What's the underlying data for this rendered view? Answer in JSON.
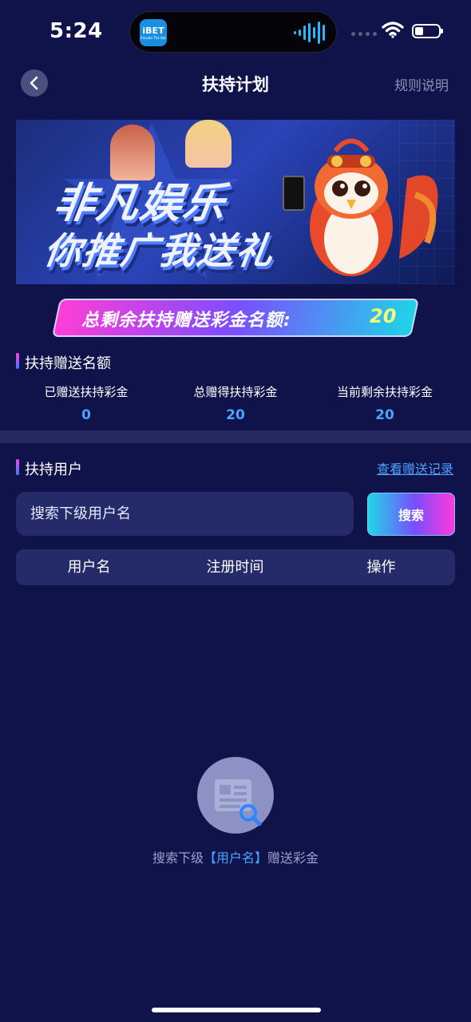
{
  "status_bar": {
    "time": "5:24",
    "app_badge": "iBET",
    "app_badge_sub": "Elevate The Bet"
  },
  "nav": {
    "title": "扶持计划",
    "rules_label": "规则说明",
    "back_icon": "chevron-left-icon"
  },
  "banner": {
    "line1": "非凡娱乐",
    "line2": "你推广我送礼"
  },
  "quota": {
    "label": "总剩余扶持赠送彩金名额:",
    "value": "20"
  },
  "support_section": {
    "title": "扶持赠送名额",
    "stats": [
      {
        "label": "已赠送扶持彩金",
        "value": "0"
      },
      {
        "label": "总赠得扶持彩金",
        "value": "20"
      },
      {
        "label": "当前剩余扶持彩金",
        "value": "20"
      }
    ]
  },
  "users_section": {
    "title": "扶持用户",
    "records_link": "查看赠送记录",
    "search_placeholder": "搜索下级用户名",
    "search_button": "搜索",
    "columns": [
      "用户名",
      "注册时间",
      "操作"
    ]
  },
  "empty_state": {
    "prefix": "搜索下级",
    "highlight": "【用户名】",
    "suffix": "赠送彩金",
    "icon": "document-search-icon"
  },
  "colors": {
    "background": "#10134a",
    "card": "#252a68",
    "accent_blue": "#4da3ff",
    "quota_value": "#f4ff7a"
  }
}
